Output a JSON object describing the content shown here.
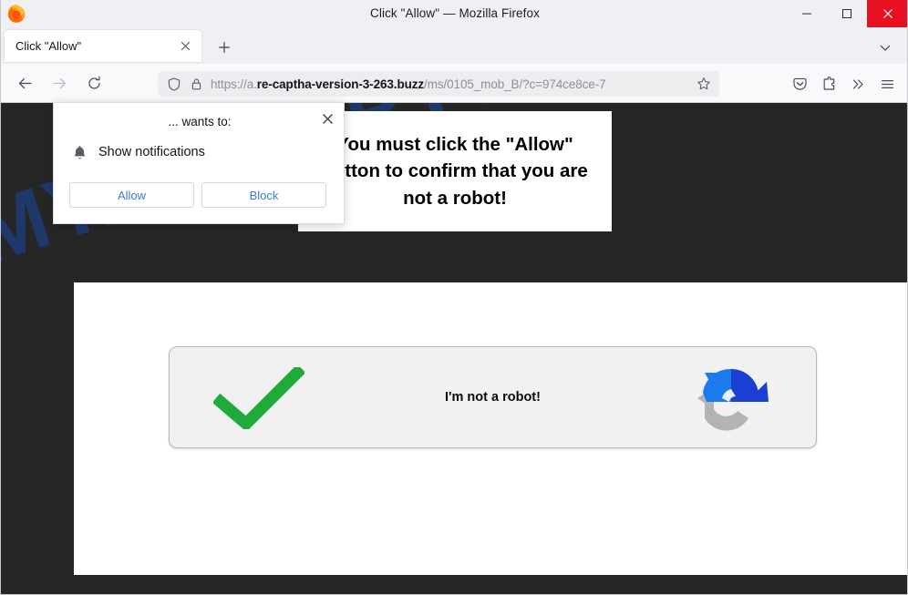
{
  "window": {
    "title": "Click \"Allow\" — Mozilla Firefox",
    "minimize_label": "Minimize",
    "maximize_label": "Maximize",
    "close_label": "Close"
  },
  "tabs": {
    "items": [
      {
        "title": "Click \"Allow\"",
        "close_label": "Close tab"
      }
    ],
    "new_tab_label": "New tab",
    "list_all_tabs_label": "List all tabs"
  },
  "toolbar": {
    "back_label": "Go back one page",
    "forward_label": "Go forward one page",
    "reload_label": "Reload current page",
    "bookmark_label": "Bookmark this page",
    "pocket_label": "Save to Pocket",
    "extension_label": "Extensions",
    "overflow_label": "More tools",
    "menu_label": "Open application menu"
  },
  "urlbar": {
    "scheme": "https://a.",
    "host": "re-captha-version-3-263.buzz",
    "path": "/ms/0105_mob_B/?c=974ce8ce-7",
    "full": "https://a.re-captha-version-3-263.buzz/ms/0105_mob_B/?c=974ce8ce-7",
    "shield_icon": "tracking-protection-shield-icon",
    "lock_icon": "padlock-icon",
    "star_icon": "star-icon"
  },
  "notification_popup": {
    "header": "... wants to:",
    "permission": "Show notifications",
    "permission_icon": "bell-icon",
    "allow_label": "Allow",
    "block_label": "Block",
    "close_label": "Close",
    "link_color": "#3b7bd6"
  },
  "page": {
    "banner_message": "You must click the \"Allow\" button to confirm that you are not a robot!",
    "captcha": {
      "label": "I'm not a robot!",
      "check_icon": "green-checkmark-icon",
      "check_color": "#1faa3c",
      "logo_icon": "recaptcha-logo-icon",
      "logo_colors": {
        "light_blue": "#1b7aec",
        "dark_blue": "#1b3fd0",
        "gray": "#b3b3b3"
      }
    },
    "watermark": "MYANTISPYWARE.COM",
    "background_color": "#262626"
  }
}
